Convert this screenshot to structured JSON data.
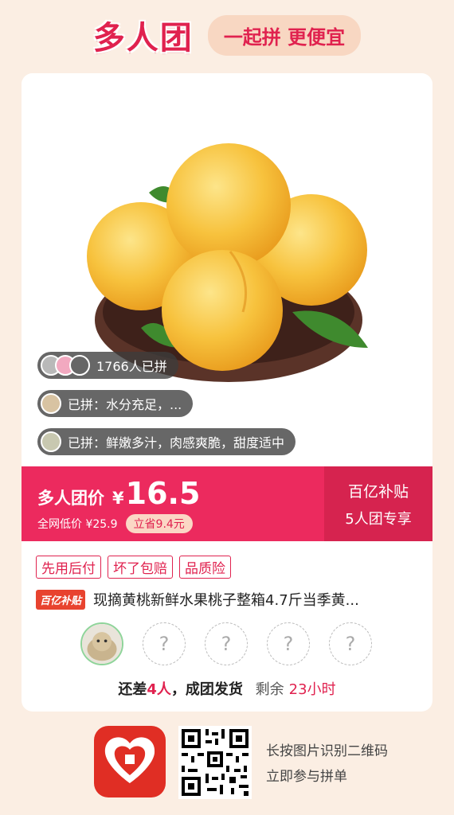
{
  "header": {
    "brand": "多人团",
    "slogan": "一起拼 更便宜"
  },
  "product": {
    "image_icon": "yellow-peach-photo",
    "joined_count_text": "1766人已拼",
    "reviews": [
      {
        "text": "已拼：水分充足，..."
      },
      {
        "text": "已拼：鲜嫩多汁，肉感爽脆，甜度适中"
      }
    ]
  },
  "price": {
    "label": "多人团价",
    "symbol": "¥",
    "value": "16.5",
    "original_text": "全网低价 ¥25.9",
    "save_text": "立省9.4元",
    "subsidy_title": "百亿补贴",
    "subsidy_sub": "5人团专享"
  },
  "tags": [
    "先用后付",
    "坏了包赔",
    "品质险"
  ],
  "title": {
    "badge": "百亿补贴",
    "text": "现摘黄桃新鲜水果桃子整箱4.7斤当季黄..."
  },
  "group": {
    "placeholder": "?",
    "status_prefix": "还差",
    "status_count": "4人",
    "status_suffix": "，成团发货",
    "remaining_label": "剩余",
    "remaining_time": "23小时"
  },
  "footer": {
    "line1": "长按图片识别二维码",
    "line2": "立即参与拼单"
  },
  "colors": {
    "accent": "#e0224f",
    "price_bar": "#ec2a5e",
    "background": "#fbeee3"
  }
}
